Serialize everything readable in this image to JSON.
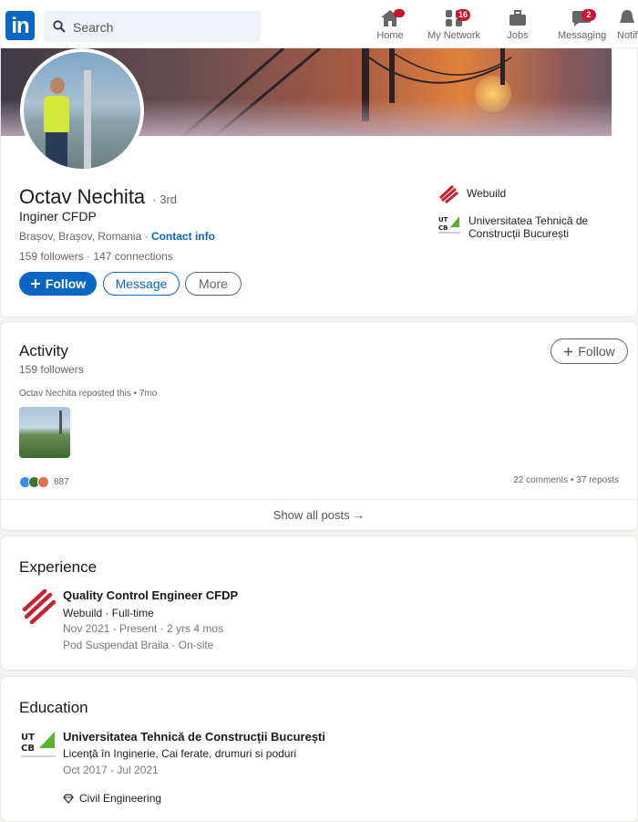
{
  "nav": {
    "logo": "in",
    "search_placeholder": "Search",
    "items": [
      {
        "label": "Home",
        "badge": ""
      },
      {
        "label": "My Network",
        "badge": "16"
      },
      {
        "label": "Jobs",
        "badge": ""
      },
      {
        "label": "Messaging",
        "badge": "2"
      },
      {
        "label": "Notif",
        "badge": ""
      }
    ]
  },
  "profile": {
    "name": "Octav Nechita",
    "degree": "· 3rd",
    "headline": "Inginer CFDP",
    "location": "Brașov, Brașov, Romania · ",
    "contact_info": "Contact info",
    "followers": "159 followers",
    "connections": "147 connections",
    "stats_sep": " · ",
    "follow_label": "Follow",
    "message_label": "Message",
    "more_label": "More",
    "orgs": [
      {
        "name": "Webuild"
      },
      {
        "name": "Universitatea Tehnică de Construcții București"
      }
    ]
  },
  "activity": {
    "title": "Activity",
    "followers": "159 followers",
    "follow_label": "Follow",
    "repost_line": "Octav Nechita reposted this • 7mo",
    "reaction_count": "887",
    "comments_reposts": "22 comments • 37 reposts",
    "show_all": "Show all posts →"
  },
  "experience": {
    "title": "Experience",
    "items": [
      {
        "role": "Quality Control Engineer CFDP",
        "company": "Webuild · Full-time",
        "dates": "Nov 2021 - Present · 2 yrs 4 mos",
        "place": "Pod Suspendat Braila · On-site"
      }
    ]
  },
  "education": {
    "title": "Education",
    "items": [
      {
        "school": "Universitatea Tehnică de Construcții București",
        "degree": "Licență în Inginerie, Cai ferate, drumuri si poduri",
        "dates": "Oct 2017 - Jul 2021",
        "skill": "Civil Engineering"
      }
    ]
  },
  "colors": {
    "brand": "#0a66c2",
    "badge": "#cb112d",
    "webuild_red": "#c8202f",
    "utcb_green": "#5bb030"
  },
  "icons": [
    "search-icon",
    "home-icon",
    "network-icon",
    "jobs-icon",
    "messaging-icon",
    "notifications-icon",
    "plus-icon",
    "arrow-right-icon",
    "diamond-icon"
  ]
}
